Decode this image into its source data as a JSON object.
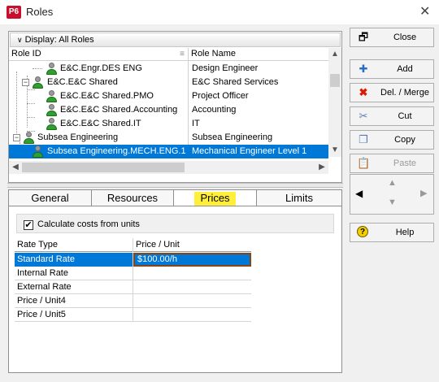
{
  "window": {
    "app_logo": "P6",
    "title": "Roles",
    "close_glyph": "✕"
  },
  "grid": {
    "display_label": "Display: All Roles",
    "columns": [
      "Role ID",
      "Role Name"
    ],
    "rows": [
      {
        "id": "E&C.Engr.DES ENG",
        "name": "Design Engineer"
      },
      {
        "id": "E&C.E&C Shared",
        "name": "E&C Shared Services"
      },
      {
        "id": "E&C.E&C Shared.PMO",
        "name": "Project Officer"
      },
      {
        "id": "E&C.E&C Shared.Accounting",
        "name": "Accounting"
      },
      {
        "id": "E&C.E&C Shared.IT",
        "name": "IT"
      },
      {
        "id": "Subsea Engineering",
        "name": "Subsea Engineering"
      },
      {
        "id": "Subsea Engineering.MECH.ENG.1",
        "name": "Mechanical Engineer Level 1"
      }
    ]
  },
  "tabs": [
    "General",
    "Resources",
    "Prices",
    "Limits"
  ],
  "prices": {
    "checkbox_label": "Calculate costs from units",
    "columns": [
      "Rate Type",
      "Price / Unit"
    ],
    "rates": [
      {
        "type": "Standard Rate",
        "price": "$100.00/h"
      },
      {
        "type": "Internal Rate",
        "price": ""
      },
      {
        "type": "External Rate",
        "price": ""
      },
      {
        "type": "Price / Unit4",
        "price": ""
      },
      {
        "type": "Price / Unit5",
        "price": ""
      }
    ]
  },
  "buttons": {
    "close": "Close",
    "add": "Add",
    "delete_merge": "Del. / Merge",
    "cut": "Cut",
    "copy": "Copy",
    "paste": "Paste",
    "help": "Help"
  }
}
